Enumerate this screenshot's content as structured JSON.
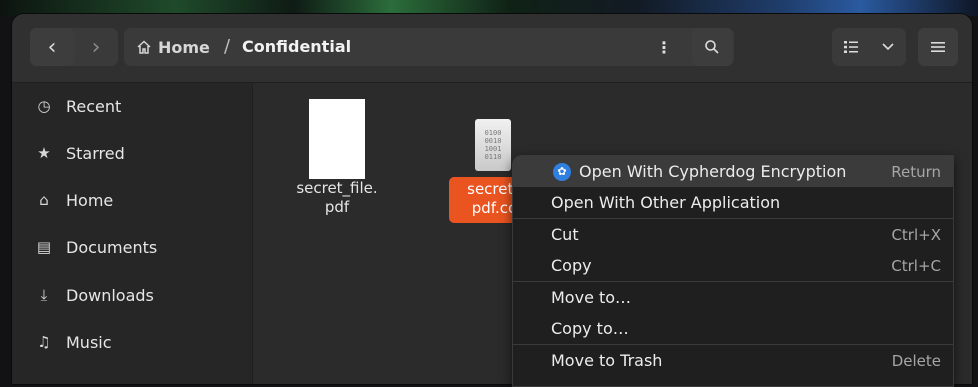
{
  "header": {
    "path_home": "Home",
    "path_separator": "/",
    "path_current": "Confidential",
    "back_icon": "‹",
    "forward_icon": "›",
    "path_menu_icon": "⋮",
    "search_icon": "⌕",
    "view_icon": "☰",
    "dropdown_icon": "⌄",
    "main_menu_icon": "≡"
  },
  "sidebar": {
    "items": [
      {
        "label": "Recent",
        "icon": "◷"
      },
      {
        "label": "Starred",
        "icon": "★"
      },
      {
        "label": "Home",
        "icon": "⌂"
      },
      {
        "label": "Documents",
        "icon": "▤"
      },
      {
        "label": "Downloads",
        "icon": "⤓"
      },
      {
        "label": "Music",
        "icon": "♫"
      }
    ]
  },
  "files": [
    {
      "name_line1": "secret_file.",
      "name_line2": "pdf"
    },
    {
      "name_line1": "secret_",
      "name_line2": "pdf.cc",
      "thumb_lines": [
        "0100",
        "0010",
        "1001",
        "0110"
      ]
    }
  ],
  "context_menu": {
    "items": [
      {
        "label": "Open With Cypherdog Encryption",
        "accel": "Return"
      },
      {
        "label": "Open With Other Application",
        "accel": ""
      },
      {
        "label": "Cut",
        "accel": "Ctrl+X"
      },
      {
        "label": "Copy",
        "accel": "Ctrl+C"
      },
      {
        "label": "Move to…",
        "accel": ""
      },
      {
        "label": "Copy to…",
        "accel": ""
      },
      {
        "label": "Move to Trash",
        "accel": "Delete"
      }
    ]
  },
  "colors": {
    "accent": "#e95420",
    "cypherdog_icon": "#2f7fe0"
  }
}
